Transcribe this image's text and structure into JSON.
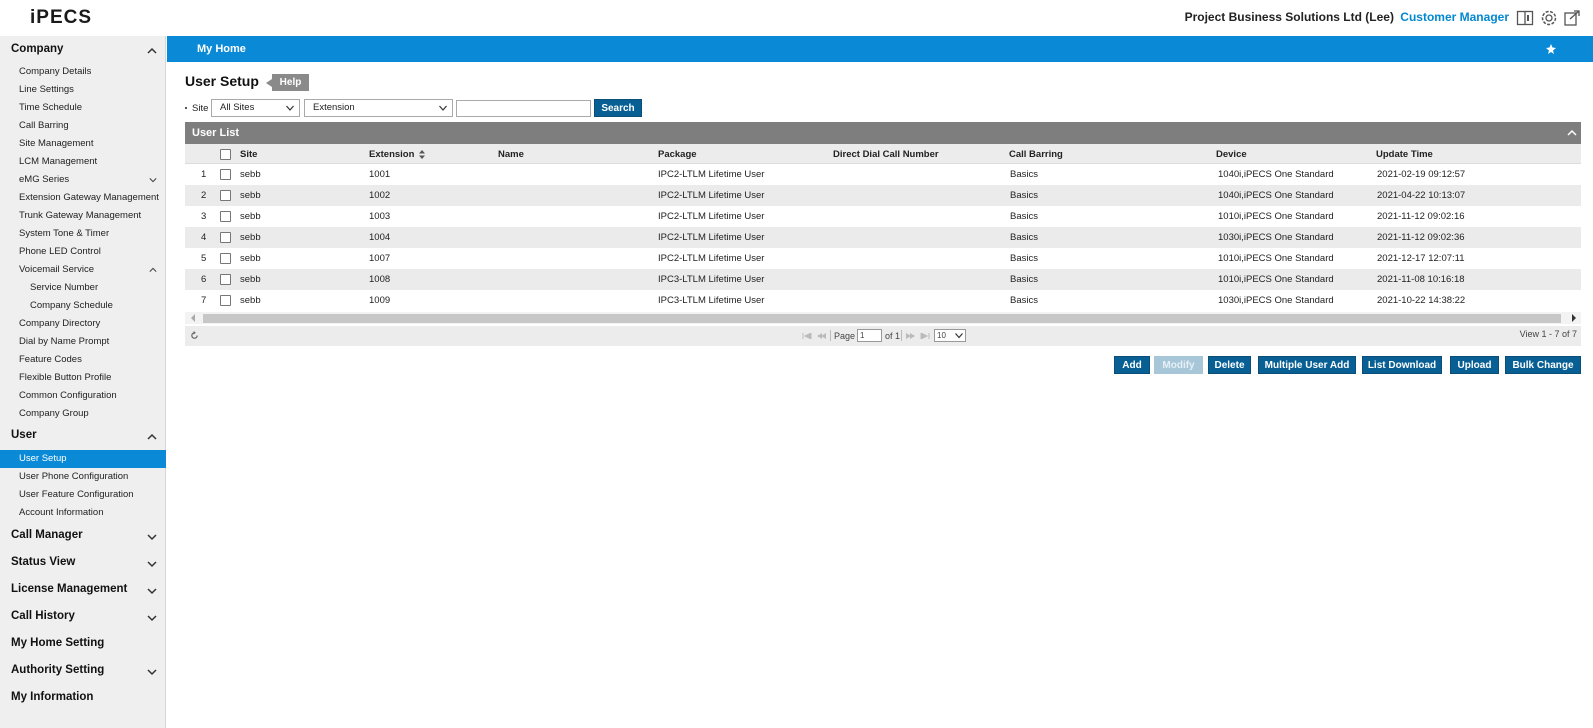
{
  "header": {
    "logo_text": "iPECS",
    "company": "Project Business Solutions Ltd (Lee)",
    "role": "Customer Manager"
  },
  "sidebar": {
    "sections": [
      {
        "label": "Company"
      },
      {
        "label": "User"
      },
      {
        "label": "Call Manager"
      },
      {
        "label": "Status View"
      },
      {
        "label": "License Management"
      },
      {
        "label": "Call History"
      },
      {
        "label": "My Home Setting"
      },
      {
        "label": "Authority Setting"
      },
      {
        "label": "My Information"
      }
    ],
    "company_items": [
      "Company Details",
      "Line Settings",
      "Time Schedule",
      "Call Barring",
      "Site Management",
      "LCM Management",
      "eMG Series",
      "Extension Gateway Management",
      "Trunk Gateway Management",
      "System Tone & Timer",
      "Phone LED Control",
      "Voicemail Service",
      "Service Number",
      "Company Schedule",
      "Company Directory",
      "Dial by Name Prompt",
      "Feature Codes",
      "Flexible Button Profile",
      "Common Configuration",
      "Company Group"
    ],
    "user_items": [
      "User Setup",
      "User Phone Configuration",
      "User Feature Configuration",
      "Account Information"
    ]
  },
  "main": {
    "bar_title": "My Home",
    "page_title": "User Setup",
    "help_label": "Help",
    "search": {
      "site_label": "Site",
      "site_value": "All Sites",
      "field_value": "Extension",
      "query": "",
      "button_label": "Search"
    },
    "list_title": "User List",
    "columns": [
      "Site",
      "Extension",
      "Name",
      "Package",
      "Direct Dial Call Number",
      "Call Barring",
      "Device",
      "Update Time"
    ],
    "rows": [
      {
        "num": "1",
        "site": "sebb",
        "extension": "1001",
        "name": "",
        "package": "IPC2-LTLM Lifetime User",
        "ddi": "",
        "barring": "Basics",
        "device": "1040i,iPECS One Standard",
        "updated": "2021-02-19 09:12:57"
      },
      {
        "num": "2",
        "site": "sebb",
        "extension": "1002",
        "name": "",
        "package": "IPC2-LTLM Lifetime User",
        "ddi": "",
        "barring": "Basics",
        "device": "1040i,iPECS One Standard",
        "updated": "2021-04-22 10:13:07"
      },
      {
        "num": "3",
        "site": "sebb",
        "extension": "1003",
        "name": "",
        "package": "IPC2-LTLM Lifetime User",
        "ddi": "",
        "barring": "Basics",
        "device": "1010i,iPECS One Standard",
        "updated": "2021-11-12 09:02:16"
      },
      {
        "num": "4",
        "site": "sebb",
        "extension": "1004",
        "name": "",
        "package": "IPC2-LTLM Lifetime User",
        "ddi": "",
        "barring": "Basics",
        "device": "1030i,iPECS One Standard",
        "updated": "2021-11-12 09:02:36"
      },
      {
        "num": "5",
        "site": "sebb",
        "extension": "1007",
        "name": "",
        "package": "IPC2-LTLM Lifetime User",
        "ddi": "",
        "barring": "Basics",
        "device": "1010i,iPECS One Standard",
        "updated": "2021-12-17 12:07:11"
      },
      {
        "num": "6",
        "site": "sebb",
        "extension": "1008",
        "name": "",
        "package": "IPC3-LTLM Lifetime User",
        "ddi": "",
        "barring": "Basics",
        "device": "1010i,iPECS One Standard",
        "updated": "2021-11-08 10:16:18"
      },
      {
        "num": "7",
        "site": "sebb",
        "extension": "1009",
        "name": "",
        "package": "IPC3-LTLM Lifetime User",
        "ddi": "",
        "barring": "Basics",
        "device": "1030i,iPECS One Standard",
        "updated": "2021-10-22 14:38:22"
      }
    ],
    "pager": {
      "page_label": "Page",
      "page_value": "1",
      "of_label": "of 1",
      "page_size": "10",
      "view_text": "View 1 - 7 of 7"
    },
    "actions": [
      "Add",
      "Modify",
      "Delete",
      "Multiple User Add",
      "List Download",
      "Upload",
      "Bulk Change"
    ]
  },
  "colors": {
    "accent": "#0a8ad6",
    "button": "#075f93",
    "panel_header": "#7e7e7e"
  }
}
